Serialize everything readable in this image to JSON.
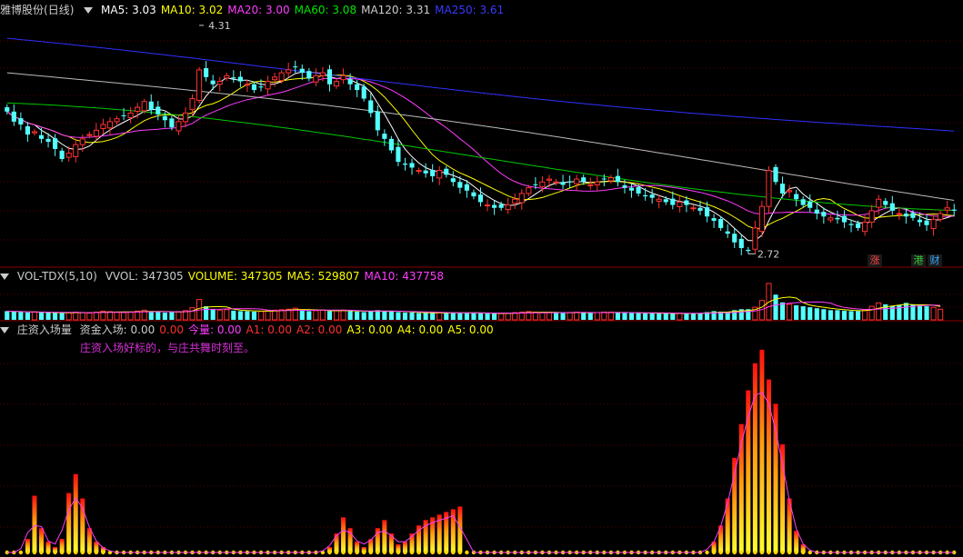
{
  "main": {
    "stock_name": "雅博股份",
    "period": "(日线)",
    "ma": [
      {
        "label": "MA5: 3.03",
        "color": "#ffffff"
      },
      {
        "label": "MA10: 3.02",
        "color": "#ffff00"
      },
      {
        "label": "MA20: 3.00",
        "color": "#ff3cff"
      },
      {
        "label": "MA60: 3.08",
        "color": "#00e600"
      },
      {
        "label": "MA120: 3.31",
        "color": "#cccccc"
      },
      {
        "label": "MA250: 3.61",
        "color": "#3a3aff"
      }
    ],
    "high_label": "4.31",
    "low_label": "2.72",
    "badges": [
      {
        "text": "涨",
        "color": "#ff4040"
      },
      {
        "text": "港",
        "color": "#33cc33"
      },
      {
        "text": "财",
        "color": "#33aaff"
      }
    ]
  },
  "vol": {
    "name": "VOL-TDX(5,10)",
    "items": [
      {
        "label": "VVOL: 347305",
        "color": "#cccccc"
      },
      {
        "label": "VOLUME: 347305",
        "color": "#ffff00"
      },
      {
        "label": "MA5: 529807",
        "color": "#ffff00"
      },
      {
        "label": "MA10: 437758",
        "color": "#ff3cff"
      }
    ]
  },
  "zj": {
    "name": "庄资入场量",
    "items": [
      {
        "label": "资金入场: 0.00",
        "color": "#cccccc"
      },
      {
        "label": "0.00",
        "color": "#ff3030"
      },
      {
        "label": "今量: 0.00",
        "color": "#ff3cff"
      },
      {
        "label": "A1: 0.00",
        "color": "#ff3030"
      },
      {
        "label": "A2: 0.00",
        "color": "#ff3030"
      },
      {
        "label": "A3: 0.00",
        "color": "#ffff00"
      },
      {
        "label": "A4: 0.00",
        "color": "#ffff00"
      },
      {
        "label": "A5: 0.00",
        "color": "#ffff00"
      }
    ],
    "note": "庄资入场好标的，与庄共舞时刻至。"
  },
  "chart_data": {
    "type": "candlestick",
    "price_range": [
      2.64,
      4.36
    ],
    "high": 4.31,
    "low": 2.72,
    "up_color": "#ff3232",
    "down_color": "#54ffff",
    "closes": [
      3.71,
      3.64,
      3.62,
      3.55,
      3.57,
      3.52,
      3.5,
      3.45,
      3.38,
      3.42,
      3.48,
      3.52,
      3.55,
      3.58,
      3.62,
      3.64,
      3.66,
      3.68,
      3.7,
      3.74,
      3.78,
      3.72,
      3.69,
      3.65,
      3.6,
      3.64,
      3.7,
      3.8,
      4.0,
      3.95,
      3.9,
      3.92,
      3.96,
      3.94,
      3.92,
      3.9,
      3.86,
      3.88,
      3.92,
      3.95,
      3.98,
      4.0,
      4.02,
      3.98,
      3.94,
      3.96,
      3.98,
      3.9,
      3.92,
      3.96,
      3.9,
      3.86,
      3.8,
      3.7,
      3.58,
      3.52,
      3.44,
      3.36,
      3.34,
      3.32,
      3.3,
      3.28,
      3.26,
      3.3,
      3.27,
      3.22,
      3.18,
      3.16,
      3.12,
      3.08,
      3.06,
      3.04,
      3.04,
      3.06,
      3.1,
      3.14,
      3.18,
      3.2,
      3.22,
      3.24,
      3.22,
      3.2,
      3.22,
      3.24,
      3.22,
      3.2,
      3.22,
      3.24,
      3.25,
      3.22,
      3.18,
      3.16,
      3.14,
      3.12,
      3.11,
      3.1,
      3.08,
      3.06,
      3.08,
      3.06,
      3.04,
      3.02,
      2.98,
      2.95,
      2.9,
      2.86,
      2.8,
      2.76,
      2.74,
      2.9,
      3.05,
      3.3,
      3.22,
      3.14,
      3.16,
      3.1,
      3.06,
      3.04,
      3.0,
      2.98,
      2.97,
      2.96,
      2.94,
      2.92,
      2.9,
      2.94,
      3.02,
      3.1,
      3.06,
      3.02,
      3.0,
      2.98,
      2.97,
      2.94,
      2.92,
      2.96,
      3.0,
      3.04,
      3.02
    ],
    "volumes": [
      18,
      17,
      16,
      15,
      16,
      15,
      15,
      14,
      14,
      15,
      16,
      15,
      14,
      16,
      18,
      17,
      16,
      15,
      16,
      18,
      20,
      17,
      16,
      15,
      16,
      17,
      19,
      25,
      42,
      28,
      22,
      20,
      21,
      19,
      18,
      18,
      17,
      18,
      19,
      20,
      21,
      22,
      24,
      20,
      18,
      19,
      20,
      18,
      19,
      20,
      18,
      17,
      16,
      18,
      20,
      18,
      17,
      16,
      15,
      15,
      14,
      14,
      14,
      15,
      14,
      15,
      15,
      14,
      14,
      14,
      13,
      13,
      13,
      14,
      15,
      16,
      17,
      16,
      15,
      15,
      15,
      14,
      15,
      16,
      15,
      14,
      15,
      16,
      16,
      15,
      14,
      14,
      14,
      14,
      14,
      13,
      13,
      13,
      14,
      13,
      13,
      14,
      16,
      18,
      17,
      16,
      20,
      22,
      22,
      26,
      40,
      75,
      52,
      36,
      32,
      30,
      28,
      26,
      24,
      22,
      20,
      20,
      19,
      18,
      18,
      20,
      28,
      35,
      32,
      28,
      30,
      35,
      32,
      30,
      28,
      26,
      22
    ],
    "zj_values": [
      0,
      0,
      0,
      0,
      0,
      0,
      0,
      0,
      0,
      0,
      0,
      0,
      0,
      0,
      0,
      0,
      0,
      0,
      0,
      0,
      0,
      0,
      0,
      0,
      0,
      0,
      0,
      0,
      0,
      0,
      0,
      0,
      0,
      0,
      0,
      0,
      0,
      0,
      0,
      0,
      0,
      0,
      0,
      0,
      0,
      0,
      0,
      0,
      0,
      0,
      0,
      0,
      0,
      0,
      0,
      0,
      0,
      0,
      0,
      0,
      0,
      0,
      0,
      0,
      0,
      0,
      0,
      0,
      0,
      0,
      0,
      0,
      0,
      0,
      0,
      0,
      0,
      0,
      0,
      0,
      0,
      0,
      0,
      0,
      0,
      0,
      0,
      0,
      0,
      0,
      0,
      0,
      0,
      0,
      0,
      0,
      0,
      0,
      0,
      0,
      0,
      0,
      0,
      0,
      0,
      0,
      0,
      0,
      0,
      0,
      0,
      0,
      0,
      0,
      0,
      0,
      0,
      0,
      0,
      0,
      0,
      0,
      0,
      0,
      0,
      0,
      0,
      0,
      0,
      0,
      0,
      0,
      0,
      0,
      0,
      0,
      0,
      0
    ],
    "zj_hist": [
      0,
      0,
      0,
      10,
      42,
      18,
      8,
      4,
      10,
      44,
      58,
      40,
      18,
      8,
      4,
      0,
      0,
      0,
      0,
      0,
      0,
      0,
      0,
      0,
      0,
      0,
      0,
      0,
      0,
      0,
      0,
      0,
      0,
      0,
      0,
      0,
      0,
      0,
      0,
      0,
      0,
      0,
      0,
      0,
      0,
      0,
      0,
      0,
      0,
      0,
      0,
      0,
      0,
      0,
      0,
      0,
      0,
      0,
      0,
      0,
      0,
      0,
      0,
      0,
      0,
      0,
      0,
      0,
      0,
      0,
      0,
      0,
      0,
      0,
      0,
      0,
      0,
      0,
      0,
      0,
      0,
      0,
      0,
      0,
      0,
      0,
      0,
      0,
      0,
      0,
      0,
      0,
      0,
      0,
      0,
      0,
      0,
      0,
      0,
      0,
      0,
      0,
      0,
      0,
      0,
      0,
      0,
      0,
      0,
      0,
      0,
      0,
      0,
      0,
      0,
      0,
      0,
      0,
      0,
      0,
      0,
      0,
      0,
      0,
      0,
      0,
      0,
      0,
      0,
      0,
      0,
      0,
      0,
      0,
      0,
      0,
      0,
      0
    ],
    "zj_range": [
      0,
      1
    ]
  }
}
